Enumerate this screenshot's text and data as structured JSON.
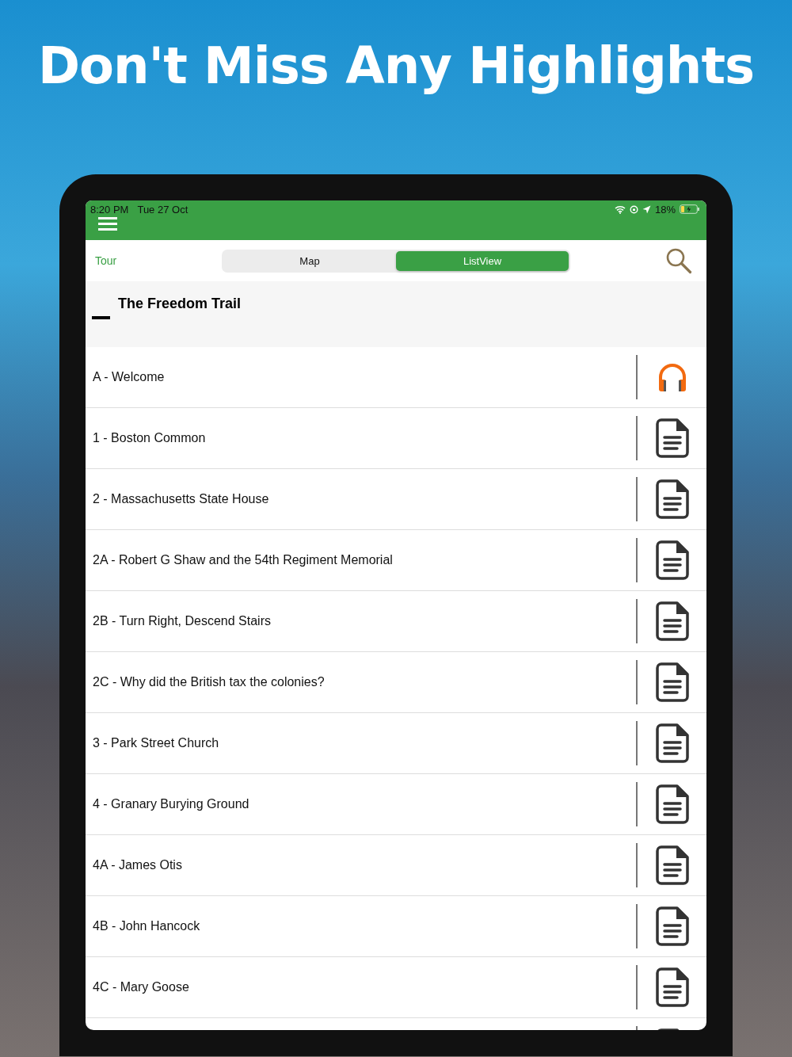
{
  "headline": "Don't Miss Any Highlights",
  "status_bar": {
    "time": "8:20 PM",
    "date": "Tue 27 Oct",
    "battery": "18%"
  },
  "toolbar": {
    "link": "Tour",
    "tabs": [
      {
        "label": "Map",
        "selected": false
      },
      {
        "label": "ListView",
        "selected": true
      }
    ]
  },
  "tour": {
    "title": "The Freedom Trail",
    "stops": [
      {
        "label": "A - Welcome",
        "kind": "audio"
      },
      {
        "label": "1 - Boston Common",
        "kind": "text"
      },
      {
        "label": "2 - Massachusetts State House",
        "kind": "text"
      },
      {
        "label": "2A - Robert G Shaw and the 54th Regiment Memorial",
        "kind": "text"
      },
      {
        "label": "2B - Turn Right, Descend Stairs",
        "kind": "text"
      },
      {
        "label": "2C - Why did the British tax the colonies?",
        "kind": "text"
      },
      {
        "label": "3 - Park Street Church",
        "kind": "text"
      },
      {
        "label": "4 - Granary Burying Ground",
        "kind": "text"
      },
      {
        "label": "4A - James Otis",
        "kind": "text"
      },
      {
        "label": "4B - John Hancock",
        "kind": "text"
      },
      {
        "label": "4C - Mary Goose",
        "kind": "text"
      },
      {
        "kind": "text"
      }
    ]
  }
}
